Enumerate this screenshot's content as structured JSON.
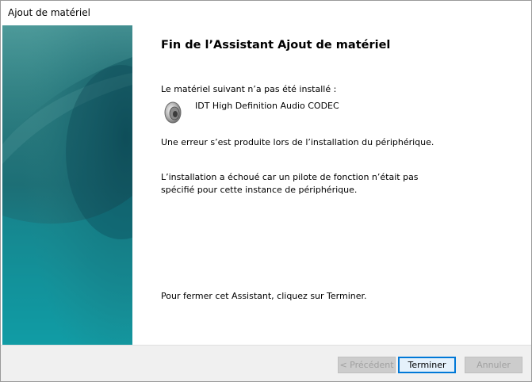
{
  "window": {
    "title": "Ajout de matériel"
  },
  "content": {
    "heading": "Fin de l’Assistant Ajout de matériel",
    "not_installed_label": "Le matériel suivant n’a pas été installé :",
    "device_name": "IDT High Definition Audio CODEC",
    "device_icon": "speaker-icon",
    "error_line": "Une erreur s’est produite lors de l’installation du périphérique.",
    "detail_line1": "L’installation a échoué car un pilote de fonction n’était pas",
    "detail_line2": "spécifié pour cette instance de périphérique.",
    "close_hint": "Pour fermer cet Assistant, cliquez sur Terminer."
  },
  "buttons": {
    "back_label": "< Précédent",
    "finish_label": "Terminer",
    "cancel_label": "Annuler"
  }
}
